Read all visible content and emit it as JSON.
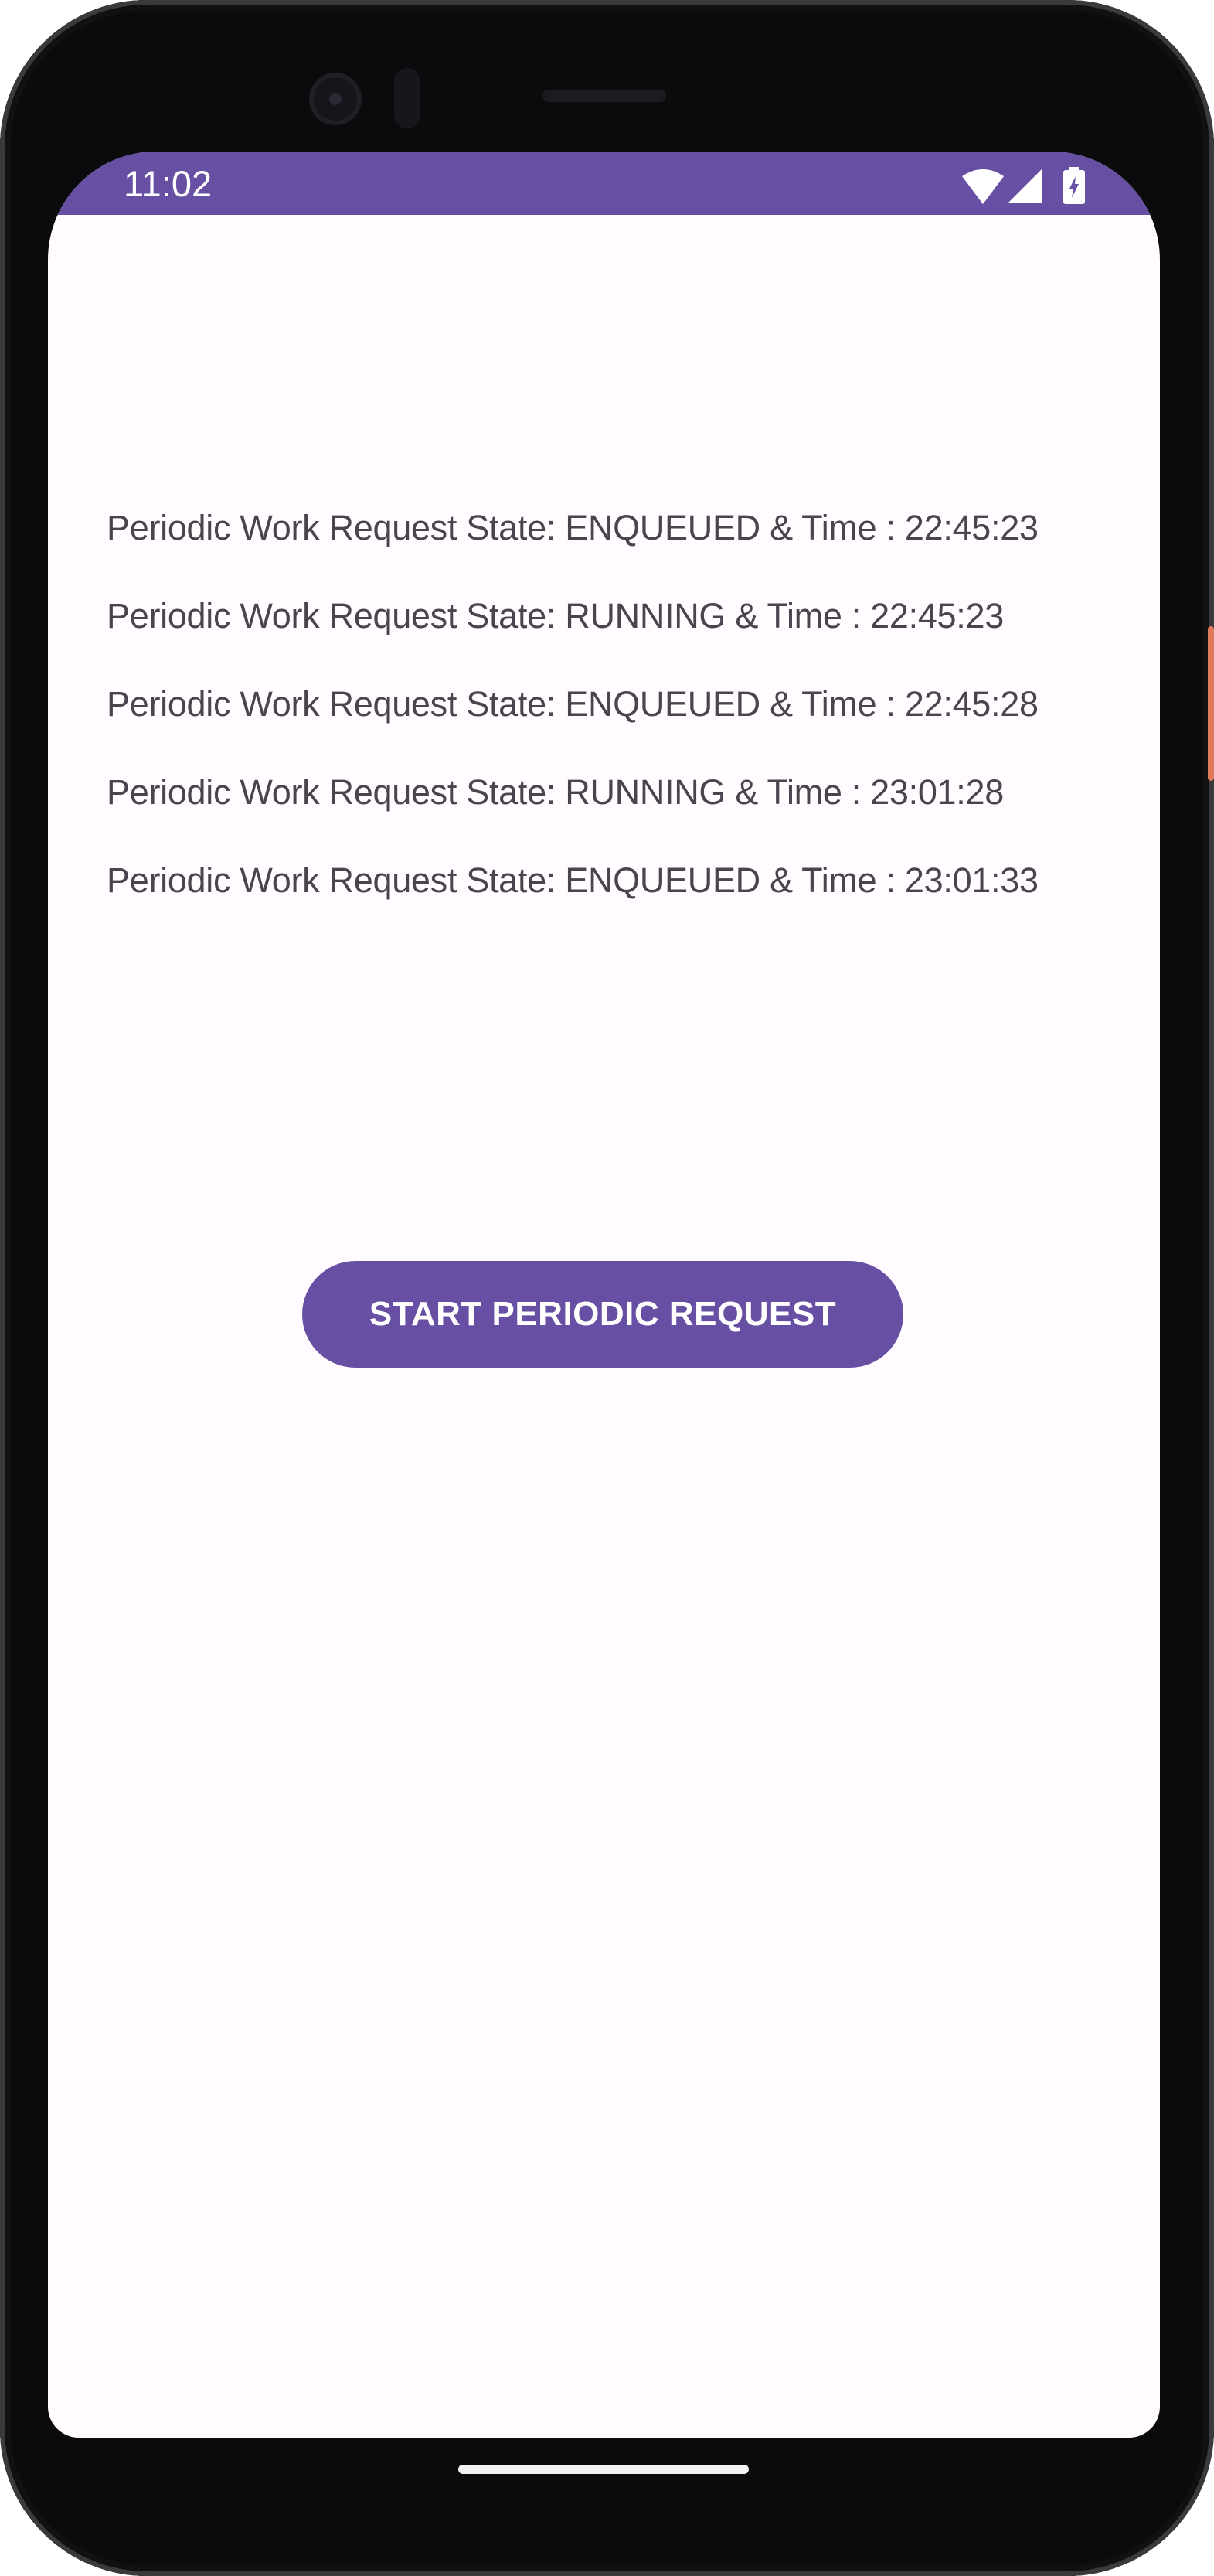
{
  "status_bar": {
    "time": "11:02",
    "icons": [
      "wifi-icon",
      "cellular-signal-icon",
      "battery-charging-icon"
    ],
    "color": "#6750A4"
  },
  "log_lines": [
    "Periodic Work Request State: ENQUEUED & Time : 22:45:23",
    "Periodic Work Request State: RUNNING & Time : 22:45:23",
    "Periodic Work Request State: ENQUEUED & Time : 22:45:28",
    "Periodic Work Request State: RUNNING & Time : 23:01:28",
    "Periodic Work Request State: ENQUEUED & Time : 23:01:33"
  ],
  "button": {
    "label": "START PERIODIC REQUEST",
    "color": "#6750A4"
  }
}
